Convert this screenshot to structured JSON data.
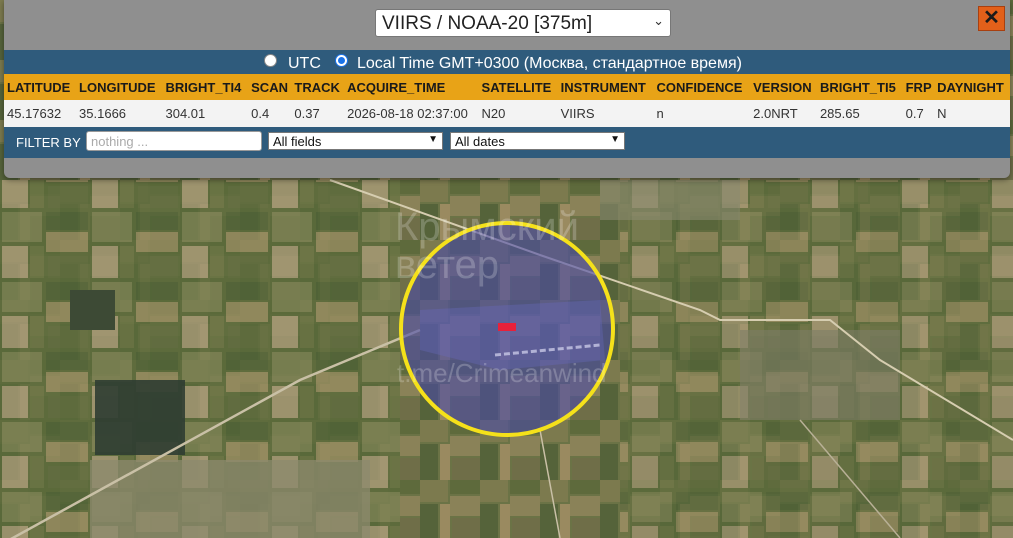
{
  "header": {
    "satellite_select": "VIIRS / NOAA-20 [375m]",
    "close_label": "✕"
  },
  "timezone": {
    "utc_label": "UTC",
    "local_label": "Local Time GMT+0300 (Москва, стандартное время)",
    "selected": "local"
  },
  "table": {
    "headers": [
      "LATITUDE",
      "LONGITUDE",
      "BRIGHT_TI4",
      "SCAN",
      "TRACK",
      "ACQUIRE_TIME",
      "SATELLITE",
      "INSTRUMENT",
      "CONFIDENCE",
      "VERSION",
      "BRIGHT_TI5",
      "FRP",
      "DAYNIGHT"
    ],
    "row": [
      "45.17632",
      "35.1666",
      "304.01",
      "0.4",
      "0.37",
      "2026-08-18 02:37:00",
      "N20",
      "VIIRS",
      "n",
      "2.0NRT",
      "285.65",
      "0.7",
      "N"
    ]
  },
  "filter": {
    "label": "FILTER BY",
    "placeholder": "nothing ...",
    "value": "",
    "fields_option": "All fields",
    "dates_option": "All dates"
  },
  "map": {
    "watermark_top": "Крымский\nветер",
    "watermark_bottom": "t.me/Crimeanwind",
    "circle_color": "#f5e11a",
    "hotspot_color": "#e8213a",
    "highlight_color": "#4a4aa8"
  }
}
